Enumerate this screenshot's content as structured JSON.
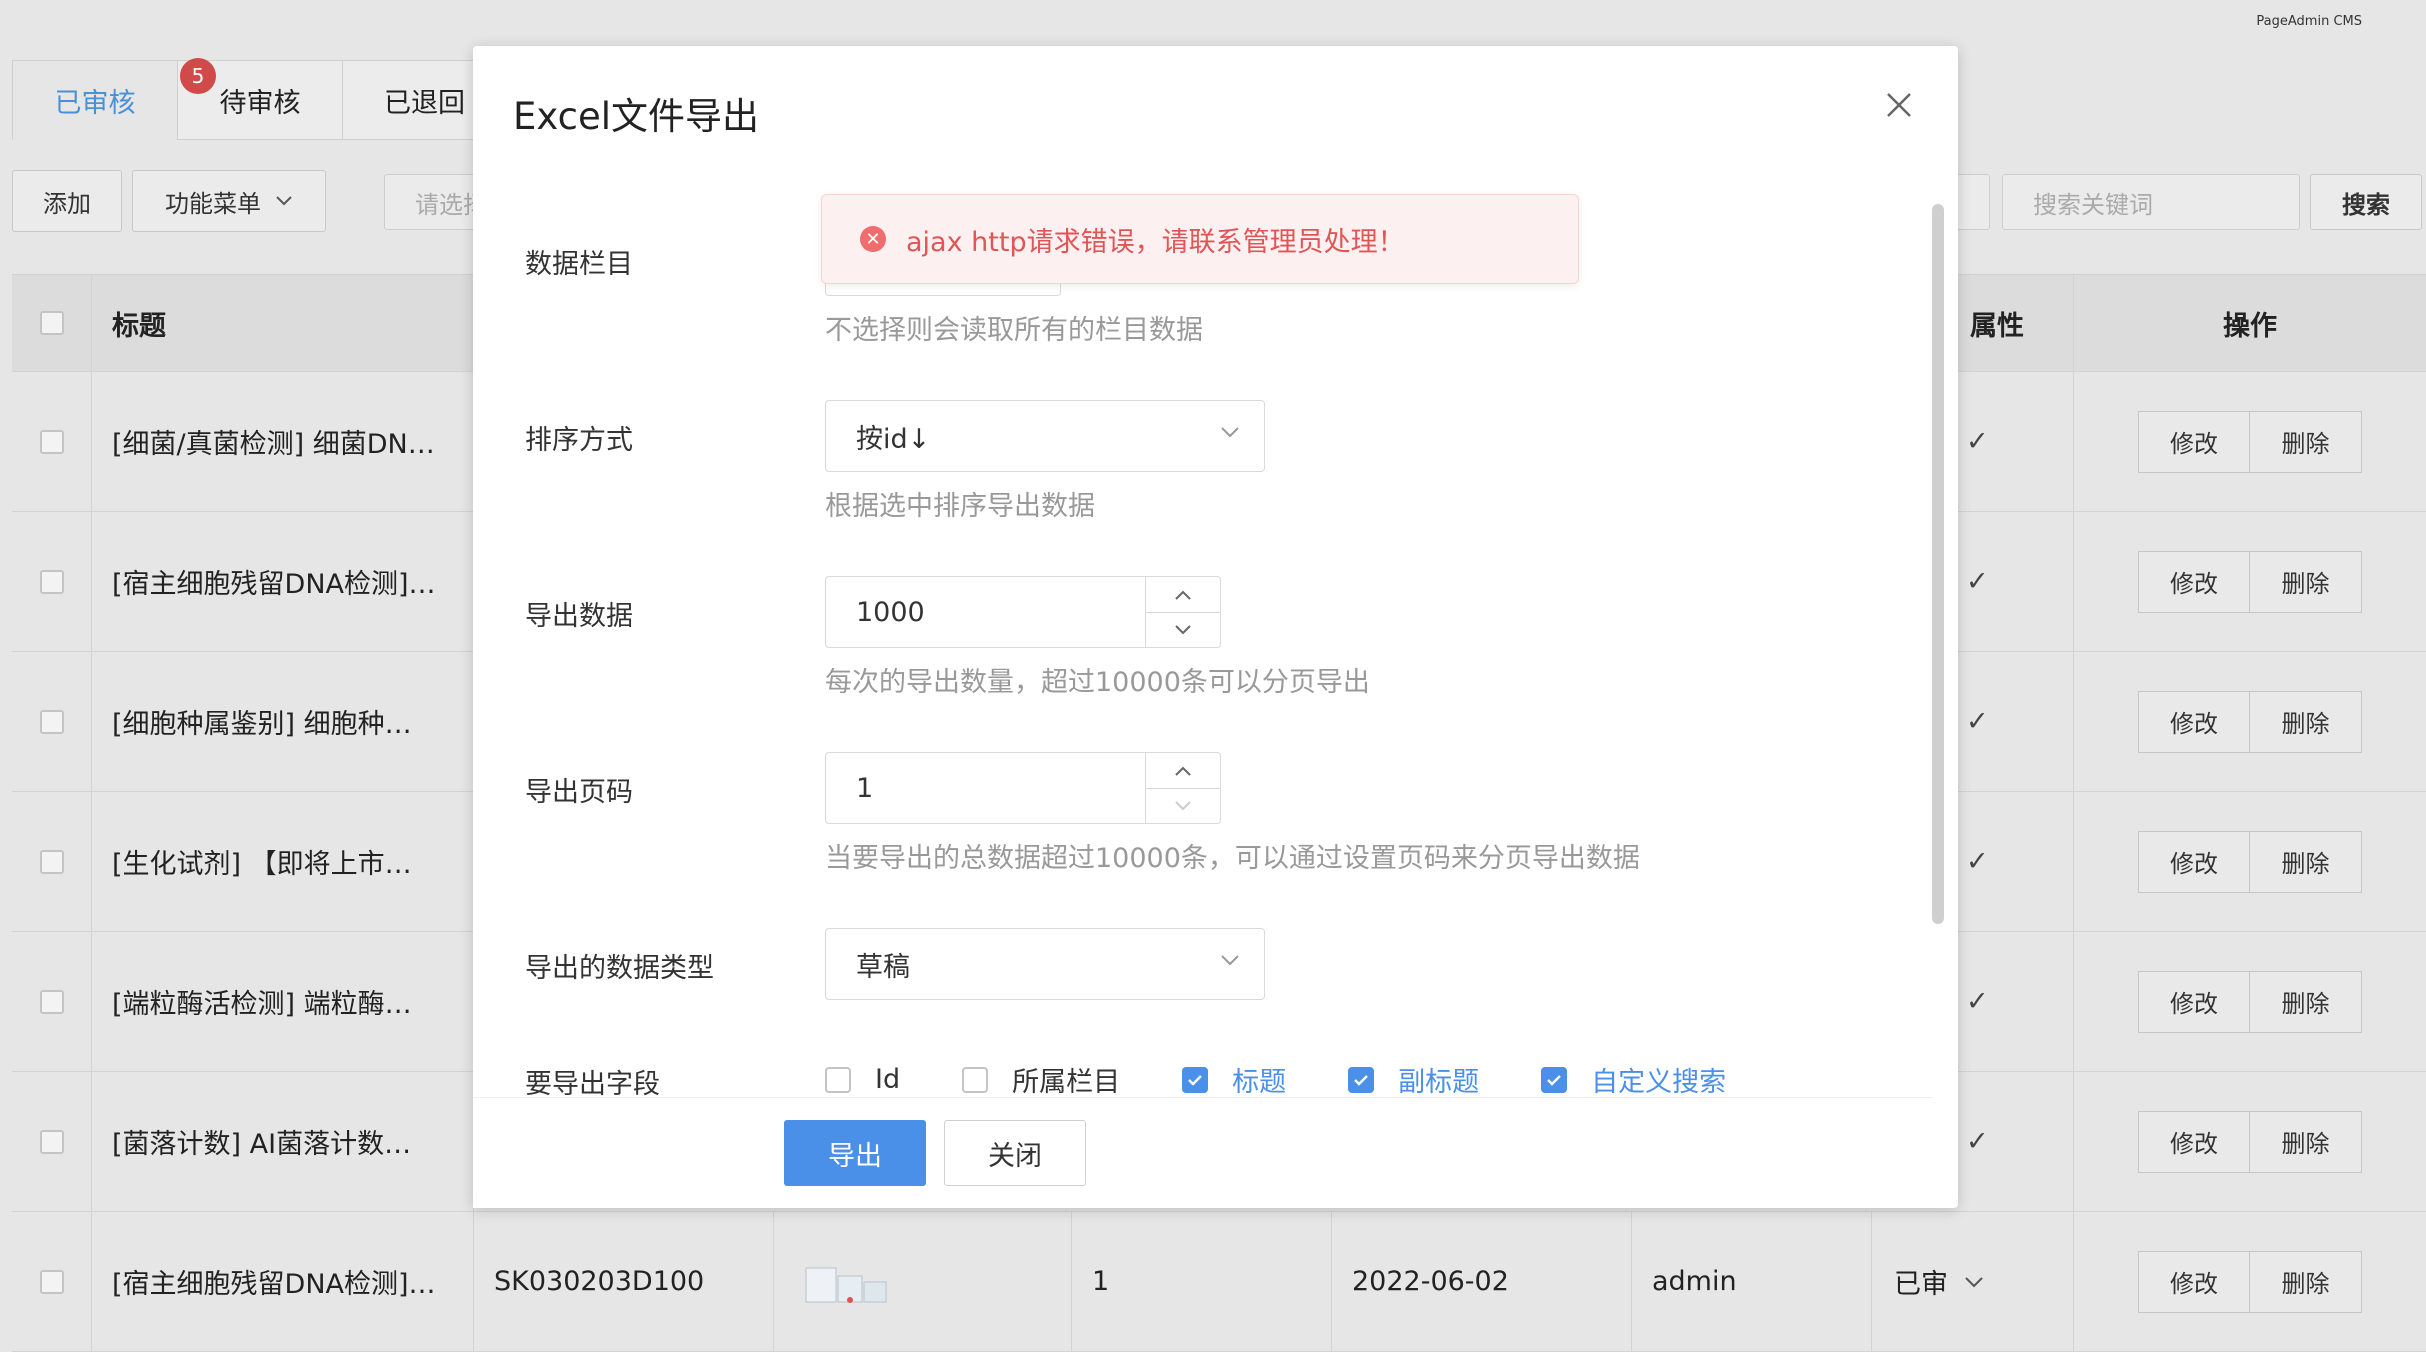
{
  "brand": "PageAdmin CMS",
  "tabs": [
    {
      "label": "已审核"
    },
    {
      "label": "待审核",
      "badge": "5"
    },
    {
      "label": "已退回"
    }
  ],
  "toolbar": {
    "add": "添加",
    "menu": "功能菜单",
    "select_placeholder": "请选择",
    "search_placeholder": "搜索关键词",
    "search_button": "搜索"
  },
  "table": {
    "headers": {
      "title": "标题",
      "attr": "属性",
      "ops": "操作"
    },
    "rows": [
      {
        "title": "[细菌/真菌检测] 细菌DN…",
        "check": "✓"
      },
      {
        "title": "[宿主细胞残留DNA检测]…",
        "check": "✓"
      },
      {
        "title": "[细胞种属鉴别] 细胞种…",
        "check": "✓"
      },
      {
        "title": "[生化试剂] 【即将上市…",
        "check": "✓"
      },
      {
        "title": "[端粒酶活检测] 端粒酶…",
        "check": "✓"
      },
      {
        "title": "[菌落计数] AI菌落计数…",
        "check": "✓"
      },
      {
        "title": "[宿主细胞残留DNA检测]…",
        "code": "SK030203D100",
        "num": "1",
        "date": "2022-06-02",
        "user": "admin",
        "status": "已审"
      }
    ],
    "edit": "修改",
    "delete": "删除"
  },
  "modal": {
    "title": "Excel文件导出",
    "alert": "ajax http请求错误，请联系管理员处理！",
    "fields": {
      "column_label": "数据栏目",
      "column_hint": "不选择则会读取所有的栏目数据",
      "sort_label": "排序方式",
      "sort_value": "按id↓",
      "sort_hint": "根据选中排序导出数据",
      "count_label": "导出数据",
      "count_value": "1000",
      "count_hint": "每次的导出数量，超过10000条可以分页导出",
      "page_label": "导出页码",
      "page_value": "1",
      "page_hint": "当要导出的总数据超过10000条，可以通过设置页码来分页导出数据",
      "type_label": "导出的数据类型",
      "type_value": "草稿",
      "fields_label": "要导出字段"
    },
    "checkboxes": [
      {
        "label": "Id",
        "checked": false
      },
      {
        "label": "所属栏目",
        "checked": false
      },
      {
        "label": "标题",
        "checked": true
      },
      {
        "label": "副标题",
        "checked": true
      },
      {
        "label": "自定义搜索",
        "checked": true
      }
    ],
    "export_button": "导出",
    "close_button": "关闭"
  },
  "colors": {
    "accent": "#4a8fe8",
    "error": "#e05656",
    "badge": "#d14a4a"
  }
}
